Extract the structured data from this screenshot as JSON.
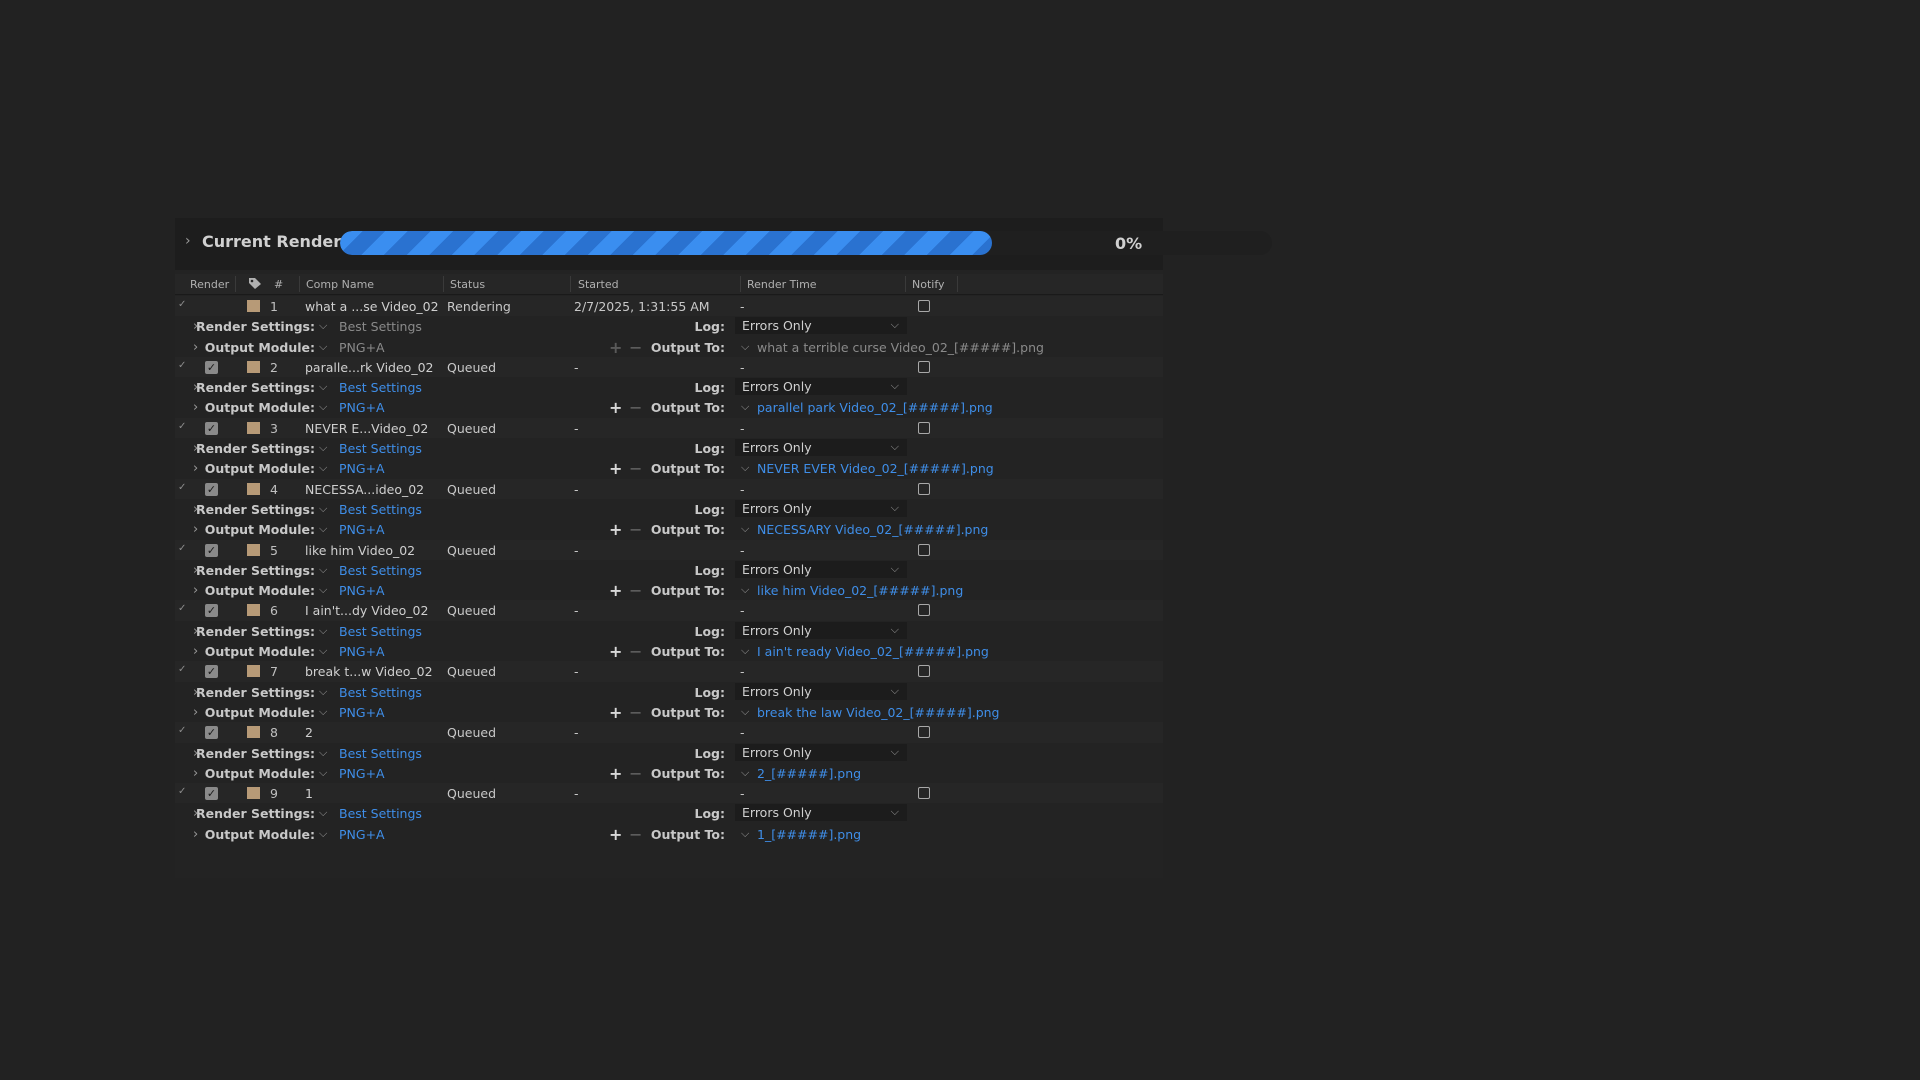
{
  "header": {
    "title": "Current Render",
    "progress_text": "0%",
    "progress_value": 0.7
  },
  "columns": {
    "render": "Render",
    "num": "#",
    "comp_name": "Comp Name",
    "status": "Status",
    "started": "Started",
    "render_time": "Render Time",
    "notify": "Notify"
  },
  "labels": {
    "render_settings": "Render Settings:",
    "output_module": "Output Module:",
    "log": "Log:",
    "output_to": "Output To:"
  },
  "items": [
    {
      "num": "1",
      "comp": "what a ...se Video_02",
      "status": "Rendering",
      "started": "2/7/2025, 1:31:55 AM",
      "render_time": "-",
      "render_settings": "Best Settings",
      "output_module": "PNG+A",
      "log": "Errors Only",
      "output_to": "what a terrible curse Video_02_[#####].png",
      "active": true
    },
    {
      "num": "2",
      "comp": "paralle...rk Video_02",
      "status": "Queued",
      "started": "-",
      "render_time": "-",
      "render_settings": "Best Settings",
      "output_module": "PNG+A",
      "log": "Errors Only",
      "output_to": "parallel park Video_02_[#####].png",
      "active": false
    },
    {
      "num": "3",
      "comp": "NEVER E...Video_02",
      "status": "Queued",
      "started": "-",
      "render_time": "-",
      "render_settings": "Best Settings",
      "output_module": "PNG+A",
      "log": "Errors Only",
      "output_to": "NEVER EVER Video_02_[#####].png",
      "active": false
    },
    {
      "num": "4",
      "comp": "NECESSA...ideo_02",
      "status": "Queued",
      "started": "-",
      "render_time": "-",
      "render_settings": "Best Settings",
      "output_module": "PNG+A",
      "log": "Errors Only",
      "output_to": "NECESSARY Video_02_[#####].png",
      "active": false
    },
    {
      "num": "5",
      "comp": "like him Video_02",
      "status": "Queued",
      "started": "-",
      "render_time": "-",
      "render_settings": "Best Settings",
      "output_module": "PNG+A",
      "log": "Errors Only",
      "output_to": "like him Video_02_[#####].png",
      "active": false
    },
    {
      "num": "6",
      "comp": "I ain't...dy Video_02",
      "status": "Queued",
      "started": "-",
      "render_time": "-",
      "render_settings": "Best Settings",
      "output_module": "PNG+A",
      "log": "Errors Only",
      "output_to": "I ain't ready Video_02_[#####].png",
      "active": false
    },
    {
      "num": "7",
      "comp": "break t...w Video_02",
      "status": "Queued",
      "started": "-",
      "render_time": "-",
      "render_settings": "Best Settings",
      "output_module": "PNG+A",
      "log": "Errors Only",
      "output_to": "break the law Video_02_[#####].png",
      "active": false
    },
    {
      "num": "8",
      "comp": "2",
      "status": "Queued",
      "started": "-",
      "render_time": "-",
      "render_settings": "Best Settings",
      "output_module": "PNG+A",
      "log": "Errors Only",
      "output_to": "2_[#####].png",
      "active": false
    },
    {
      "num": "9",
      "comp": "1",
      "status": "Queued",
      "started": "-",
      "render_time": "-",
      "render_settings": "Best Settings",
      "output_module": "PNG+A",
      "log": "Errors Only",
      "output_to": "1_[#####].png",
      "active": false
    }
  ]
}
